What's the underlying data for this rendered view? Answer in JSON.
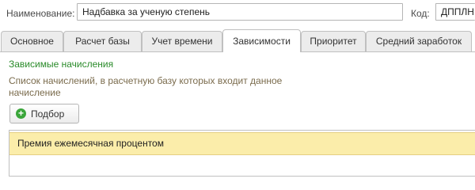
{
  "header": {
    "name_label": "Наименование:",
    "name_value": "Надбавка за ученую степень",
    "code_label": "Код:",
    "code_value": "ДППЛН"
  },
  "tabs": [
    {
      "label": "Основное",
      "active": false
    },
    {
      "label": "Расчет базы",
      "active": false
    },
    {
      "label": "Учет времени",
      "active": false
    },
    {
      "label": "Зависимости",
      "active": true
    },
    {
      "label": "Приоритет",
      "active": false
    },
    {
      "label": "Средний заработок",
      "active": false
    }
  ],
  "dependencies": {
    "title": "Зависимые начисления",
    "description": "Список начислений, в расчетную базу которых входит данное начисление",
    "pick_button_label": "Подбор",
    "pick_button_icon": "plus-circle-icon",
    "rows": [
      "Премия ежемесячная процентом"
    ]
  },
  "colors": {
    "accent_green": "#2a8b2a",
    "selected_row": "#fbedaa",
    "description_text": "#7a6b4c"
  }
}
